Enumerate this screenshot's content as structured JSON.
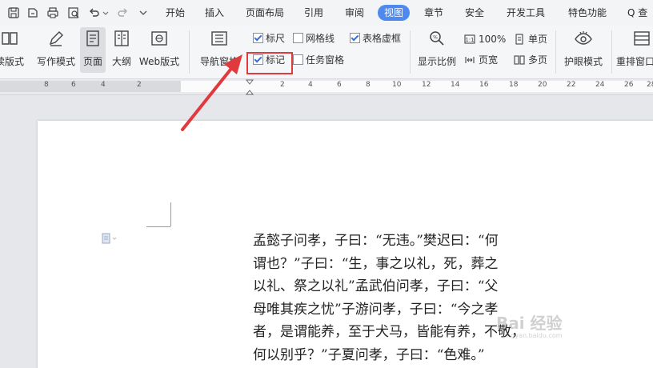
{
  "tabs": [
    "开始",
    "插入",
    "页面布局",
    "引用",
    "审阅",
    "视图",
    "章节",
    "安全",
    "开发工具",
    "特色功能"
  ],
  "active_tab": "视图",
  "search_label": "Q 查",
  "ribbon": {
    "read_mode": "读版式",
    "write_mode": "写作模式",
    "page": "页面",
    "outline": "大纲",
    "web_layout": "Web版式",
    "nav_pane": "导航窗格",
    "checkboxes": {
      "ruler": {
        "label": "标尺",
        "checked": true
      },
      "gridlines": {
        "label": "网格线",
        "checked": false
      },
      "table_gridlines": {
        "label": "表格虚框",
        "checked": true
      },
      "marks": {
        "label": "标记",
        "checked": true
      },
      "task_pane": {
        "label": "任务窗格",
        "checked": false
      }
    },
    "zoom": "显示比例",
    "zoom_100": "100%",
    "page_width": "页宽",
    "single_page": "单页",
    "multi_page": "多页",
    "eye_mode": "护眼模式",
    "rearrange": "重排窗口"
  },
  "ruler_numbers": [
    "8",
    "6",
    "4",
    "2",
    "2",
    "4",
    "6",
    "8",
    "10",
    "12",
    "14",
    "16",
    "18",
    "20",
    "22",
    "24",
    "26",
    "28"
  ],
  "document_lines": [
    "孟懿子问孝，子曰：“无违。”樊迟曰：“何",
    "谓也？”子曰：“生，事之以礼，死，葬之",
    "以礼、祭之以礼”孟武伯问孝，子曰：“父",
    "母唯其疾之忧”子游问孝，子曰：“今之孝",
    "者，是谓能养，至于犬马，皆能有养，不敬，",
    "何以别乎？”子夏问孝，子曰：“色难。”"
  ],
  "watermark": "Bai 经验",
  "watermark_sub": "jingyan.baidu.com",
  "colors": {
    "accent": "#4d8af0",
    "highlight": "#e0393e"
  }
}
